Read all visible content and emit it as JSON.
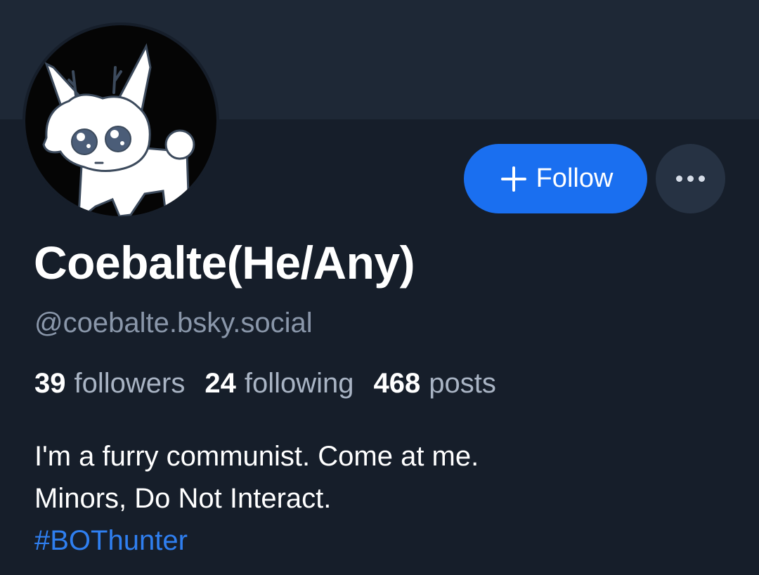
{
  "profile": {
    "display_name": "Coebalte(He/Any)",
    "handle": "@coebalte.bsky.social",
    "follow_label": "Follow",
    "more_icon": "ellipsis-icon",
    "avatar_icon": "white-deer-character-avatar"
  },
  "stats": {
    "followers_count": "39",
    "followers_label": "followers",
    "following_count": "24",
    "following_label": "following",
    "posts_count": "468",
    "posts_label": "posts"
  },
  "bio": {
    "line1": "I'm a furry communist. Come at me.",
    "line2": "Minors, Do Not Interact.",
    "hashtag": "#BOThunter"
  },
  "colors": {
    "background": "#161e2a",
    "banner": "#1e2836",
    "accent": "#1a6ff0",
    "hashtag": "#2f7ff0",
    "muted_text": "#8a97aa"
  }
}
